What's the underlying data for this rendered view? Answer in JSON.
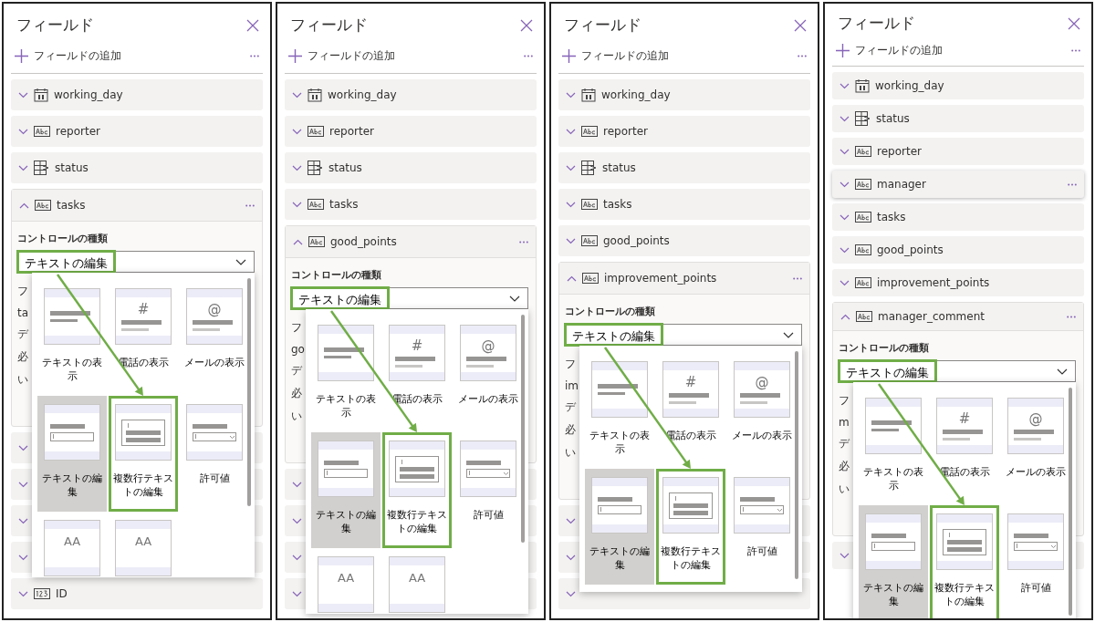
{
  "panels": [
    {
      "title": "フィールド",
      "add_label": "フィールドの追加",
      "fields": [
        {
          "name": "working_day",
          "kind": "date",
          "expanded": false
        },
        {
          "name": "reporter",
          "kind": "text",
          "expanded": false
        },
        {
          "name": "status",
          "kind": "choice",
          "expanded": false
        },
        {
          "name": "tasks",
          "kind": "text",
          "expanded": true,
          "control_label": "コントロールの種類",
          "control_value": "テキストの編集",
          "value_highlighted": true,
          "fragments": [
            "フ",
            "ta",
            "デ",
            "必",
            "い"
          ],
          "gallery": [
            {
              "label": "テキストの表示",
              "kind": "display",
              "selected": false,
              "highlighted": false
            },
            {
              "label": "電話の表示",
              "kind": "phone",
              "symbol": "#",
              "selected": false,
              "highlighted": false
            },
            {
              "label": "メールの表示",
              "kind": "email",
              "symbol": "@",
              "selected": false,
              "highlighted": false
            },
            {
              "label": "テキストの編集",
              "kind": "edit",
              "selected": true,
              "highlighted": false
            },
            {
              "label": "複数行テキストの編集",
              "kind": "multiline",
              "selected": false,
              "highlighted": true
            },
            {
              "label": "許可値",
              "kind": "allowed",
              "selected": false,
              "highlighted": false
            },
            {
              "kind": "font",
              "symbol": "AA",
              "selected": false,
              "highlighted": false
            },
            {
              "kind": "font",
              "symbol": "AA",
              "selected": false,
              "highlighted": false
            }
          ]
        },
        {
          "expanded": false
        },
        {
          "expanded": false
        },
        {
          "expanded": false
        },
        {
          "expanded": false
        },
        {
          "name": "ID",
          "kind": "number",
          "expanded": false
        }
      ]
    },
    {
      "title": "フィールド",
      "add_label": "フィールドの追加",
      "fields": [
        {
          "name": "working_day",
          "kind": "date",
          "expanded": false
        },
        {
          "name": "reporter",
          "kind": "text",
          "expanded": false
        },
        {
          "name": "status",
          "kind": "choice",
          "expanded": false
        },
        {
          "name": "tasks",
          "kind": "text",
          "expanded": false
        },
        {
          "name": "good_points",
          "kind": "text",
          "expanded": true,
          "control_label": "コントロールの種類",
          "control_value": "テキストの編集",
          "value_highlighted": true,
          "fragments": [
            "フ",
            "go",
            "デ",
            "必",
            "い"
          ],
          "gallery": [
            {
              "label": "テキストの表示",
              "kind": "display",
              "selected": false,
              "highlighted": false
            },
            {
              "label": "電話の表示",
              "kind": "phone",
              "symbol": "#",
              "selected": false,
              "highlighted": false
            },
            {
              "label": "メールの表示",
              "kind": "email",
              "symbol": "@",
              "selected": false,
              "highlighted": false
            },
            {
              "label": "テキストの編集",
              "kind": "edit",
              "selected": true,
              "highlighted": false
            },
            {
              "label": "複数行テキストの編集",
              "kind": "multiline",
              "selected": false,
              "highlighted": true
            },
            {
              "label": "許可値",
              "kind": "allowed",
              "selected": false,
              "highlighted": false
            },
            {
              "kind": "font",
              "symbol": "AA",
              "selected": false,
              "highlighted": false
            },
            {
              "kind": "font",
              "symbol": "AA",
              "selected": false,
              "highlighted": false
            }
          ]
        },
        {
          "expanded": false
        },
        {
          "expanded": false
        },
        {
          "expanded": false
        },
        {
          "expanded": false
        }
      ]
    },
    {
      "title": "フィールド",
      "add_label": "フィールドの追加",
      "fields": [
        {
          "name": "working_day",
          "kind": "date",
          "expanded": false
        },
        {
          "name": "reporter",
          "kind": "text",
          "expanded": false
        },
        {
          "name": "status",
          "kind": "choice",
          "expanded": false
        },
        {
          "name": "tasks",
          "kind": "text",
          "expanded": false
        },
        {
          "name": "good_points",
          "kind": "text",
          "expanded": false
        },
        {
          "name": "improvement_points",
          "kind": "text",
          "expanded": true,
          "control_label": "コントロールの種類",
          "control_value": "テキストの編集",
          "value_highlighted": true,
          "fragments": [
            "フ",
            "im",
            "デ",
            "必",
            "い"
          ],
          "gallery": [
            {
              "label": "テキストの表示",
              "kind": "display",
              "selected": false,
              "highlighted": false
            },
            {
              "label": "電話の表示",
              "kind": "phone",
              "symbol": "#",
              "selected": false,
              "highlighted": false
            },
            {
              "label": "メールの表示",
              "kind": "email",
              "symbol": "@",
              "selected": false,
              "highlighted": false
            },
            {
              "label": "テキストの編集",
              "kind": "edit",
              "selected": true,
              "highlighted": false
            },
            {
              "label": "複数行テキストの編集",
              "kind": "multiline",
              "selected": false,
              "highlighted": true
            },
            {
              "label": "許可値",
              "kind": "allowed",
              "selected": false,
              "highlighted": false
            }
          ]
        },
        {
          "expanded": false
        },
        {
          "expanded": false
        },
        {
          "expanded": false
        }
      ]
    },
    {
      "title": "フィールド",
      "add_label": "フィールドの追加",
      "fields": [
        {
          "name": "working_day",
          "kind": "date",
          "expanded": false
        },
        {
          "name": "status",
          "kind": "choice",
          "expanded": false
        },
        {
          "name": "reporter",
          "kind": "text",
          "expanded": false
        },
        {
          "name": "manager",
          "kind": "text",
          "expanded": false,
          "hovered": true
        },
        {
          "name": "tasks",
          "kind": "text",
          "expanded": false
        },
        {
          "name": "good_points",
          "kind": "text",
          "expanded": false
        },
        {
          "name": "improvement_points",
          "kind": "text",
          "expanded": false
        },
        {
          "name": "manager_comment",
          "kind": "text",
          "expanded": true,
          "control_label": "コントロールの種類",
          "control_value": "テキストの編集",
          "value_highlighted": true,
          "fragments": [
            "フ",
            "m",
            "デ",
            "必",
            "い"
          ],
          "gallery": [
            {
              "label": "テキストの表示",
              "kind": "display",
              "selected": false,
              "highlighted": false
            },
            {
              "label": "電話の表示",
              "kind": "phone",
              "symbol": "#",
              "selected": false,
              "highlighted": false
            },
            {
              "label": "メールの表示",
              "kind": "email",
              "symbol": "@",
              "selected": false,
              "highlighted": false
            },
            {
              "label": "テキストの編集",
              "kind": "edit",
              "selected": true,
              "highlighted": false
            },
            {
              "label": "複数行テキストの編集",
              "kind": "multiline",
              "selected": false,
              "highlighted": true
            },
            {
              "label": "許可値",
              "kind": "allowed",
              "selected": false,
              "highlighted": false
            }
          ]
        },
        {
          "expanded": false
        }
      ]
    }
  ]
}
